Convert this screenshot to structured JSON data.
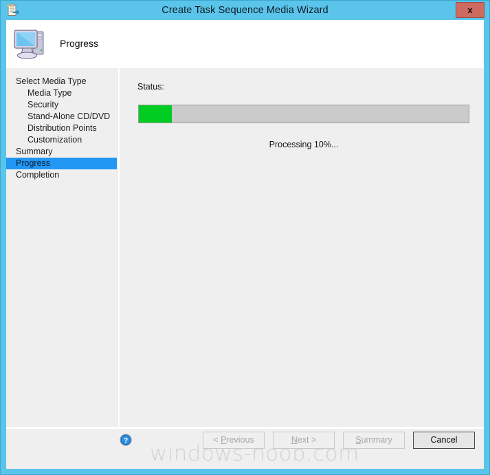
{
  "window": {
    "title": "Create Task Sequence Media Wizard",
    "icon": "task-sequence-clipboard-icon",
    "close_label": "x",
    "frame_color": "#5ac4ea",
    "close_color": "#cd6b61"
  },
  "header": {
    "title": "Progress",
    "icon": "computer-icon"
  },
  "sidebar": {
    "items": [
      {
        "label": "Select Media Type",
        "level": 0,
        "selected": false
      },
      {
        "label": "Media Type",
        "level": 1,
        "selected": false
      },
      {
        "label": "Security",
        "level": 1,
        "selected": false
      },
      {
        "label": "Stand-Alone CD/DVD",
        "level": 1,
        "selected": false
      },
      {
        "label": "Distribution Points",
        "level": 1,
        "selected": false
      },
      {
        "label": "Customization",
        "level": 1,
        "selected": false
      },
      {
        "label": "Summary",
        "level": 0,
        "selected": false
      },
      {
        "label": "Progress",
        "level": 0,
        "selected": true
      },
      {
        "label": "Completion",
        "level": 0,
        "selected": false
      }
    ],
    "selected_color": "#2196f3"
  },
  "content": {
    "status_label": "Status:",
    "progress_percent": 10,
    "progress_text": "Processing 10%...",
    "progress_fill_color": "#00cc22",
    "progress_track_color": "#cbcbcb"
  },
  "footer": {
    "help_icon": "help-circle-icon",
    "buttons": [
      {
        "name": "previous",
        "prefix": "< ",
        "accel": "P",
        "rest": "revious",
        "suffix": "",
        "enabled": false
      },
      {
        "name": "next",
        "prefix": "",
        "accel": "N",
        "rest": "ext",
        "suffix": " >",
        "enabled": false
      },
      {
        "name": "summary",
        "prefix": "",
        "accel": "S",
        "rest": "ummary",
        "suffix": "",
        "enabled": false
      },
      {
        "name": "cancel",
        "prefix": "",
        "accel": "",
        "rest": "Cancel",
        "suffix": "",
        "enabled": true
      }
    ]
  },
  "watermark": {
    "text": "windows-noob.com"
  }
}
